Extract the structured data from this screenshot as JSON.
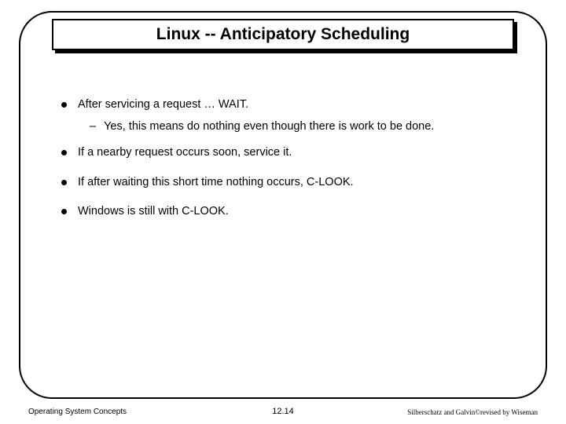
{
  "title": "Linux -- Anticipatory Scheduling",
  "bullets": [
    {
      "text": "After servicing a request … WAIT.",
      "sub": "Yes, this means do nothing even though there is work to be done."
    },
    {
      "text": "If a nearby request occurs soon, service it."
    },
    {
      "text": "If after waiting this short time nothing occurs, C-LOOK."
    },
    {
      "text": "Windows is still with C-LOOK."
    }
  ],
  "footer": {
    "left": "Operating System Concepts",
    "center": "12.14",
    "right": "Silberschatz and Galvin©revised by Wiseman"
  }
}
